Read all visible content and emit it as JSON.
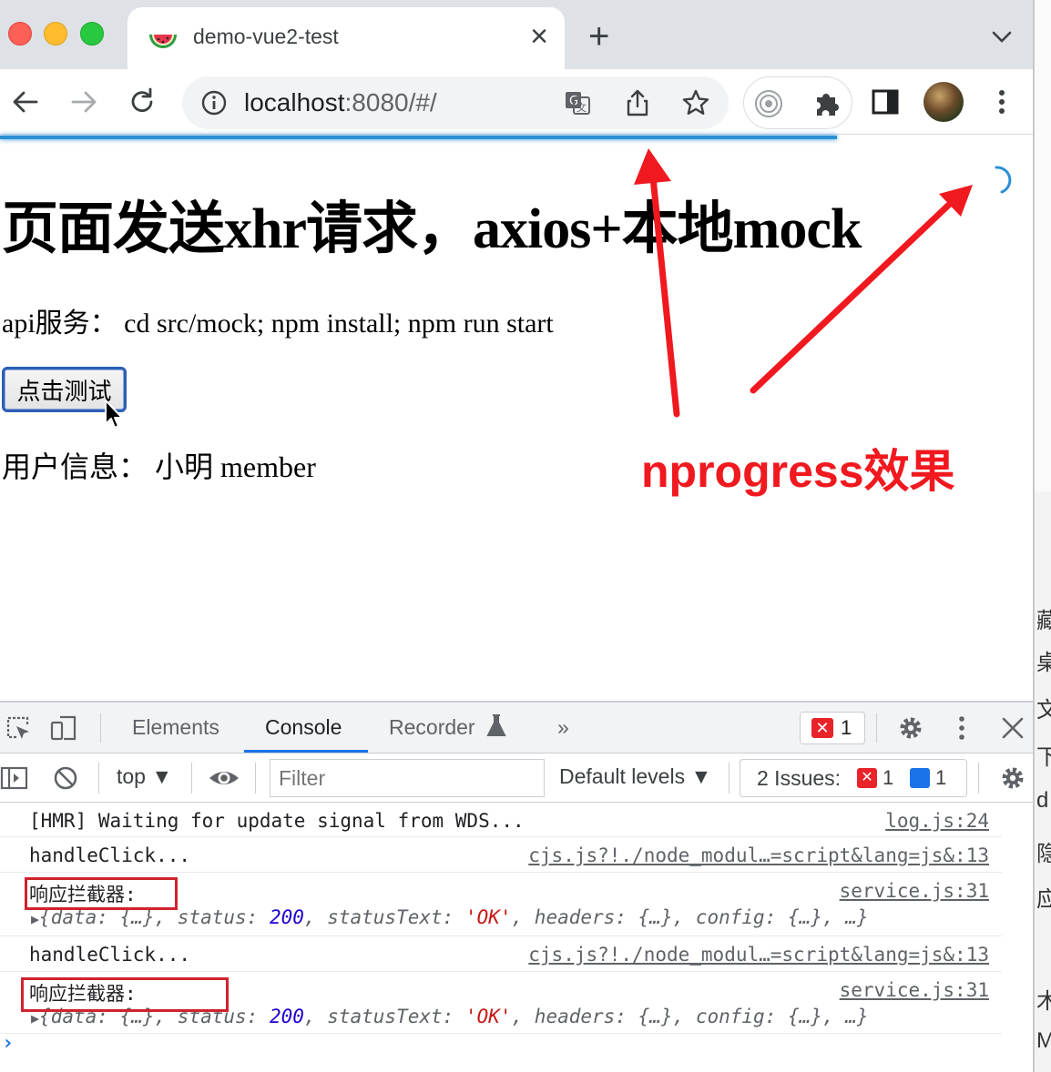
{
  "browser": {
    "tab": {
      "title": "demo-vue2-test",
      "close": "×"
    },
    "new_tab": "+",
    "address": {
      "host": "localhost",
      "rest": ":8080/#/"
    }
  },
  "page": {
    "heading": "页面发送xhr请求，axios+本地mock",
    "api_line": "api服务： cd src/mock; npm install; npm run start",
    "button_label": "点击测试",
    "user_info": "用户信息： 小明 member",
    "progress_fraction": 0.81
  },
  "annotation": {
    "text": "nprogress效果",
    "color": "#f0191f"
  },
  "devtools": {
    "tabs": [
      "Elements",
      "Console",
      "Recorder",
      "»"
    ],
    "active_tab": "Console",
    "error_count": "1",
    "context": "top ▼",
    "filter_placeholder": "Filter",
    "levels": "Default levels ▼",
    "issues_label": "2 Issues:",
    "issues_error": "1",
    "issues_info": "1",
    "logs": [
      {
        "msg": "[HMR] Waiting for update signal from WDS...",
        "src": "log.js:24"
      },
      {
        "msg": "handleClick...",
        "src": "cjs.js?!./node_modul…=script&lang=js&:13"
      },
      {
        "msg": "响应拦截器:",
        "src": "service.js:31",
        "obj": true
      },
      {
        "msg": "handleClick...",
        "src": "cjs.js?!./node_modul…=script&lang=js&:13"
      },
      {
        "msg": "响应拦截器:",
        "src": "service.js:31",
        "obj": true
      }
    ],
    "object_preview": {
      "k1": "data",
      "v1": "{…}",
      "k2": "status",
      "v2": "200",
      "k3": "statusText",
      "v3": "'OK'",
      "k4": "headers",
      "v4": "{…}",
      "k5": "config",
      "v5": "{…}",
      "tail": "…}"
    },
    "prompt": "›"
  },
  "side_window_chars": [
    "藏",
    "桌",
    "文",
    "下",
    "d",
    "隐",
    "应",
    "木",
    "M"
  ],
  "colors": {
    "accent": "#1a73e8",
    "progress": "#2b8fd6",
    "error": "#e8232a"
  }
}
